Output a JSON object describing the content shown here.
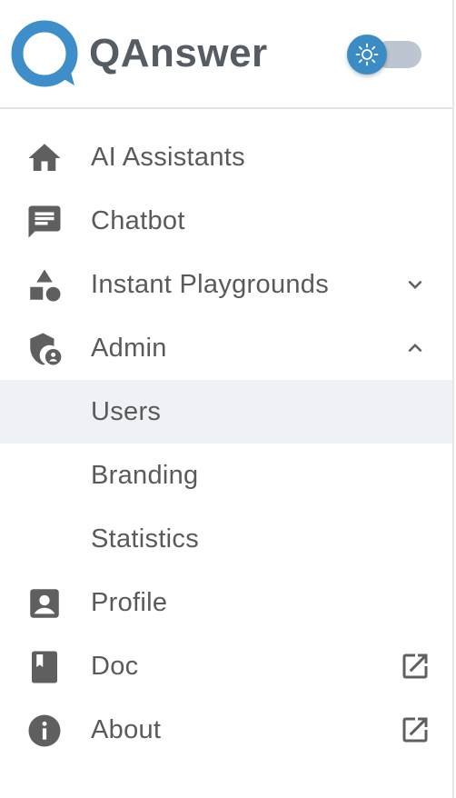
{
  "brand": {
    "name": "QAnswer",
    "logo_color": "#3d8ec9",
    "text_color": "#555c64"
  },
  "theme_toggle": {
    "icon": "sun-icon",
    "thumb_color": "#3b8cc4",
    "track_color": "#bcc6d0"
  },
  "nav": {
    "items": [
      {
        "label": "AI Assistants",
        "icon": "home-icon"
      },
      {
        "label": "Chatbot",
        "icon": "chat-icon"
      },
      {
        "label": "Instant Playgrounds",
        "icon": "shapes-icon",
        "trail": "chevron-down-icon"
      },
      {
        "label": "Admin",
        "icon": "admin-shield-icon",
        "trail": "chevron-up-icon"
      },
      {
        "label": "Users",
        "selected": true
      },
      {
        "label": "Branding"
      },
      {
        "label": "Statistics"
      },
      {
        "label": "Profile",
        "icon": "account-box-icon"
      },
      {
        "label": "Doc",
        "icon": "book-icon",
        "trail": "open-in-new-icon"
      },
      {
        "label": "About",
        "icon": "info-icon",
        "trail": "open-in-new-icon"
      }
    ]
  },
  "colors": {
    "icon": "#5f5f5f",
    "selected_bg": "#eef2f6"
  }
}
